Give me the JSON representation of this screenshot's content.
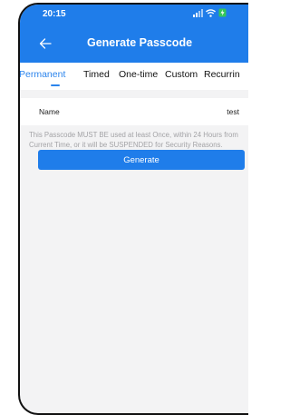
{
  "status_bar": {
    "time": "20:15",
    "icons": [
      "signal-icon",
      "wifi-icon",
      "battery-charging-icon"
    ]
  },
  "header": {
    "back_icon": "arrow-left-icon",
    "title": "Generate Passcode"
  },
  "tabs": [
    {
      "label": "Permanent",
      "active": true
    },
    {
      "label": "Timed",
      "active": false
    },
    {
      "label": "One-time",
      "active": false
    },
    {
      "label": "Custom",
      "active": false
    },
    {
      "label": "Recurrin",
      "active": false
    }
  ],
  "form": {
    "name_label": "Name",
    "name_value": "test",
    "notice": "This Passcode MUST BE used at least Once, within 24 Hours from Current Time, or it will be SUSPENDED for Security Reasons."
  },
  "generate_label": "Generate",
  "colors": {
    "primary": "#1f7dea",
    "tab_active": "#2b84ec",
    "background": "#f3f3f4",
    "notice_text": "#a3a3a6"
  }
}
